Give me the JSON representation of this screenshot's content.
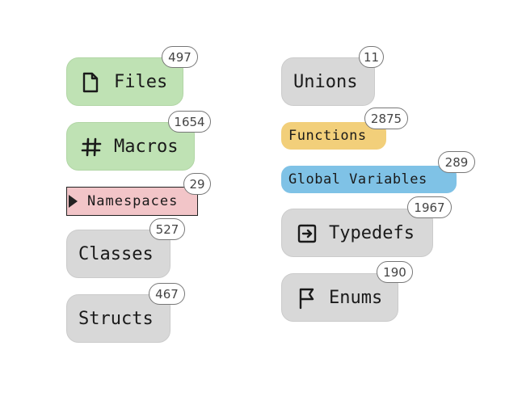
{
  "nodes": {
    "files": {
      "label": "Files",
      "count": "497",
      "icon": "file-icon",
      "color": "#bfe2b4"
    },
    "macros": {
      "label": "Macros",
      "count": "1654",
      "icon": "hash-icon",
      "color": "#bfe2b4"
    },
    "namespaces": {
      "label": "Namespaces",
      "count": "29",
      "icon": "triangle-marker-icon",
      "color": "#f2c5c8"
    },
    "classes": {
      "label": "Classes",
      "count": "527",
      "color": "#d8d8d8"
    },
    "structs": {
      "label": "Structs",
      "count": "467",
      "color": "#d8d8d8"
    },
    "unions": {
      "label": "Unions",
      "count": "11",
      "color": "#d8d8d8"
    },
    "functions": {
      "label": "Functions",
      "count": "2875",
      "color": "#f2cf7a"
    },
    "global_variables": {
      "label": "Global Variables",
      "count": "289",
      "color": "#7fc2e6"
    },
    "typedefs": {
      "label": "Typedefs",
      "count": "1967",
      "icon": "arrow-into-box-icon",
      "color": "#d8d8d8"
    },
    "enums": {
      "label": "Enums",
      "count": "190",
      "icon": "flag-icon",
      "color": "#d8d8d8"
    }
  }
}
